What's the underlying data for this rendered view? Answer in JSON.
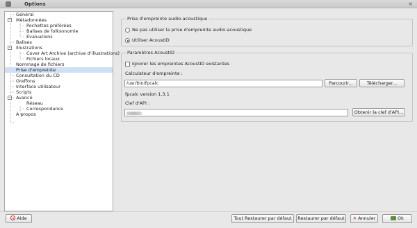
{
  "window": {
    "title": "Options"
  },
  "tree": {
    "items": [
      {
        "label": "Général",
        "indent": 0,
        "expander": ""
      },
      {
        "label": "Métadonnées",
        "indent": 0,
        "expander": "-"
      },
      {
        "label": "Pochettes préférées",
        "indent": 1,
        "expander": ""
      },
      {
        "label": "Balises de folksonomie",
        "indent": 1,
        "expander": ""
      },
      {
        "label": "Évaluations",
        "indent": 1,
        "expander": ""
      },
      {
        "label": "Balises",
        "indent": 0,
        "expander": ""
      },
      {
        "label": "Illustrations",
        "indent": 0,
        "expander": "-"
      },
      {
        "label": "Cover Art Archive (archive d'illustrations)",
        "indent": 1,
        "expander": ""
      },
      {
        "label": "Fichiers locaux",
        "indent": 1,
        "expander": ""
      },
      {
        "label": "Nommage de fichiers",
        "indent": 0,
        "expander": ""
      },
      {
        "label": "Prise d'empreinte",
        "indent": 0,
        "expander": "",
        "selected": true
      },
      {
        "label": "Consultation du CD",
        "indent": 0,
        "expander": ""
      },
      {
        "label": "Greffons",
        "indent": 0,
        "expander": ""
      },
      {
        "label": "Interface utilisateur",
        "indent": 0,
        "expander": ""
      },
      {
        "label": "Scripts",
        "indent": 0,
        "expander": ""
      },
      {
        "label": "Avancé",
        "indent": 0,
        "expander": "-"
      },
      {
        "label": "Réseau",
        "indent": 1,
        "expander": ""
      },
      {
        "label": "Correspondance",
        "indent": 1,
        "expander": ""
      },
      {
        "label": "À propos",
        "indent": 0,
        "expander": ""
      }
    ]
  },
  "fingerprint": {
    "group_title": "Prise d'empreinte audio-acoustique",
    "option_none": "Ne pas utiliser la prise d'empreinte audio-acoustique",
    "option_acoustid": "Utiliser AcoustID",
    "selected": "acoustid"
  },
  "acoustid": {
    "group_title": "Paramètres AcoustID",
    "ignore_label": "Ignorer les empreintes AcoustID existantes",
    "ignore_checked": false,
    "calc_label": "Calculateur d'empreinte :",
    "calc_value": "/usr/bin/fpcalc",
    "browse_label": "Parcourir...",
    "download_label": "Télécharger...",
    "version_text": "fpcalc version 1.3.1",
    "api_key_label": "Clef d'API :",
    "api_key_button": "Obtenir la clef d'API..."
  },
  "footer": {
    "help_label": "Aide",
    "restore_all_label": "Tout Restaurer par défaut",
    "restore_label": "Restaurer par défaut",
    "cancel_label": "Annuler",
    "ok_label": "Ok"
  }
}
